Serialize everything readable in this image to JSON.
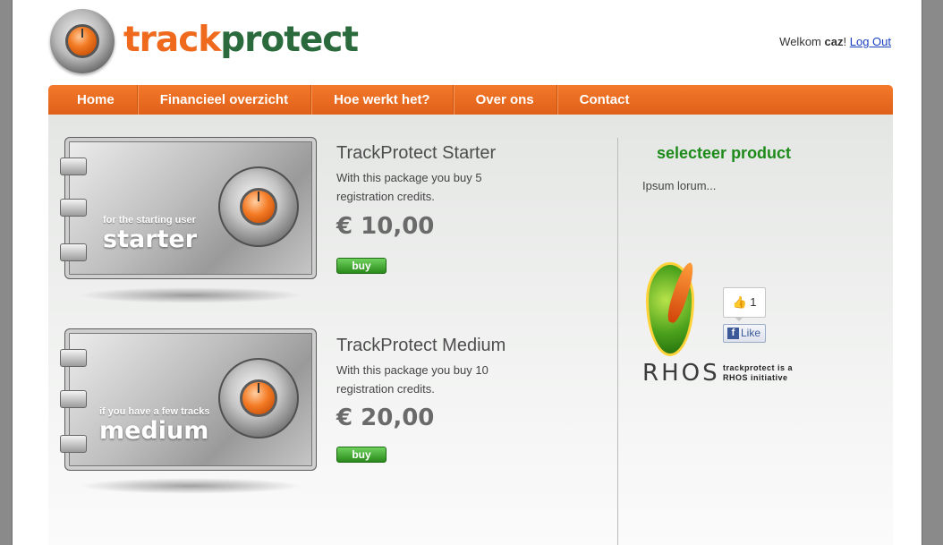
{
  "header": {
    "logo_part1": "track",
    "logo_part2": "protect",
    "welcome_prefix": "Welkom",
    "username": "caz",
    "welcome_suffix": "!",
    "logout": "Log Out"
  },
  "nav": {
    "items": [
      "Home",
      "Financieel overzicht",
      "Hoe werkt het?",
      "Over ons",
      "Contact"
    ]
  },
  "products": [
    {
      "safe_subtitle": "for the starting user",
      "safe_label": "starter",
      "title": "TrackProtect Starter",
      "description": "With this package you buy 5 registration credits.",
      "price": "€ 10,00",
      "buy_label": "buy"
    },
    {
      "safe_subtitle": "if you have a few tracks",
      "safe_label": "medium",
      "title": "TrackProtect Medium",
      "description": "With this package you buy 10 registration credits.",
      "price": "€ 20,00",
      "buy_label": "buy"
    }
  ],
  "sidebar": {
    "title": "selecteer product",
    "text": "Ipsum lorum...",
    "like_count": "1",
    "like_label": "Like",
    "rhos_word": "RHOS",
    "rhos_note": "trackprotect is a RHOS initiative"
  },
  "colors": {
    "brand_orange": "#ef6a1c",
    "brand_green": "#2b6a3c",
    "nav_orange": "#f3792a",
    "buy_green": "#2a8a1c",
    "sidebar_title_green": "#1d8a1a"
  }
}
